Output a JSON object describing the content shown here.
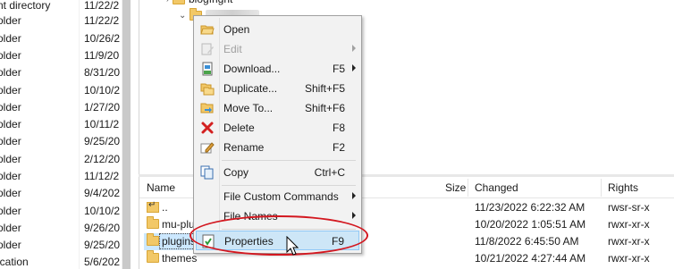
{
  "left_list": {
    "rows": [
      {
        "type": "nt directory",
        "date": "11/22/2"
      },
      {
        "type": "older",
        "date": "11/22/2"
      },
      {
        "type": "older",
        "date": "10/26/2"
      },
      {
        "type": "older",
        "date": "11/9/20"
      },
      {
        "type": "older",
        "date": "8/31/20"
      },
      {
        "type": "older",
        "date": "10/10/2"
      },
      {
        "type": "older",
        "date": "1/27/20"
      },
      {
        "type": "older",
        "date": "10/11/2"
      },
      {
        "type": "older",
        "date": "9/25/20"
      },
      {
        "type": "older",
        "date": "2/12/20"
      },
      {
        "type": "older",
        "date": "11/12/2"
      },
      {
        "type": "older",
        "date": "9/4/202"
      },
      {
        "type": "older",
        "date": "10/10/2"
      },
      {
        "type": "older",
        "date": "9/26/20"
      },
      {
        "type": "older",
        "date": "9/25/20"
      },
      {
        "type": "ication",
        "date": "5/6/202"
      }
    ]
  },
  "tree": {
    "parent_label": "blogfright",
    "child_label": ""
  },
  "file_list": {
    "headers": {
      "name": "Name",
      "size": "Size",
      "changed": "Changed",
      "rights": "Rights"
    },
    "rows": [
      {
        "name": "..",
        "changed": "11/23/2022 6:22:32 AM",
        "rights": "rwsr-sr-x",
        "icon": "parent-folder-icon"
      },
      {
        "name": "mu-plu",
        "changed": "10/20/2022 1:05:51 AM",
        "rights": "rwxr-xr-x",
        "icon": "folder-icon"
      },
      {
        "name": "plugins",
        "changed": "11/8/2022 6:45:50 AM",
        "rights": "rwxr-xr-x",
        "icon": "folder-icon"
      },
      {
        "name": "themes",
        "changed": "10/21/2022 4:27:44 AM",
        "rights": "rwxr-xr-x",
        "icon": "folder-icon"
      }
    ]
  },
  "context_menu": {
    "items": [
      {
        "label": "Open",
        "shortcut": "",
        "submenu": false,
        "disabled": false,
        "icon": "open-folder-icon"
      },
      {
        "label": "Edit",
        "shortcut": "",
        "submenu": true,
        "disabled": true,
        "icon": "edit-icon"
      },
      {
        "label": "Download...",
        "shortcut": "F5",
        "submenu": true,
        "disabled": false,
        "icon": "download-icon"
      },
      {
        "label": "Duplicate...",
        "shortcut": "Shift+F5",
        "submenu": false,
        "disabled": false,
        "icon": "duplicate-icon"
      },
      {
        "label": "Move To...",
        "shortcut": "Shift+F6",
        "submenu": false,
        "disabled": false,
        "icon": "move-icon"
      },
      {
        "label": "Delete",
        "shortcut": "F8",
        "submenu": false,
        "disabled": false,
        "icon": "delete-x-icon"
      },
      {
        "label": "Rename",
        "shortcut": "F2",
        "submenu": false,
        "disabled": false,
        "icon": "rename-icon"
      },
      {
        "label": "Copy",
        "shortcut": "Ctrl+C",
        "submenu": false,
        "disabled": false,
        "icon": "copy-icon"
      },
      {
        "label": "File Custom Commands",
        "shortcut": "",
        "submenu": true,
        "disabled": false,
        "icon": ""
      },
      {
        "label": "File Names",
        "shortcut": "",
        "submenu": true,
        "disabled": false,
        "icon": ""
      },
      {
        "label": "Properties",
        "shortcut": "F9",
        "submenu": false,
        "disabled": false,
        "icon": "properties-icon",
        "highlighted": true
      }
    ]
  },
  "colors": {
    "annotation_ellipse": "#d3171f",
    "menu_highlight": "#cde6f7",
    "selection": "#cce8ff"
  }
}
